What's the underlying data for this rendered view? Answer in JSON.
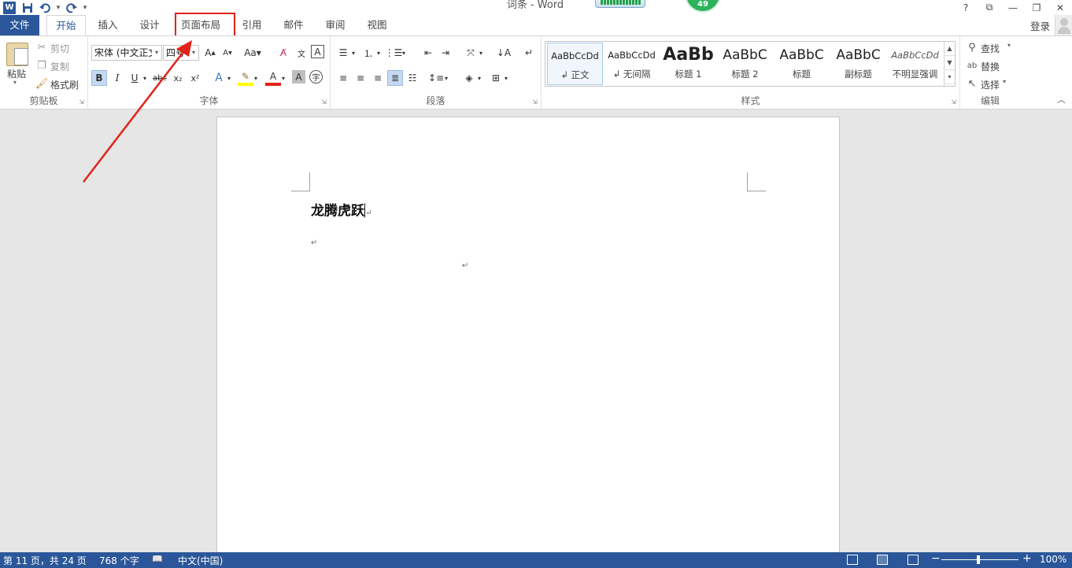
{
  "window": {
    "title": "词条 - Word",
    "help": "?",
    "restore_ribbon": "⧉",
    "minimize": "—",
    "maximize": "❐",
    "close": "✕",
    "overlay_badge": "49"
  },
  "qat": {
    "logo": "W",
    "save": "save-icon",
    "undo": "undo-icon",
    "redo": "redo-icon",
    "customize": "▾"
  },
  "tabs": [
    {
      "label": "文件"
    },
    {
      "label": "开始"
    },
    {
      "label": "插入"
    },
    {
      "label": "设计"
    },
    {
      "label": "页面布局"
    },
    {
      "label": "引用"
    },
    {
      "label": "邮件"
    },
    {
      "label": "审阅"
    },
    {
      "label": "视图"
    }
  ],
  "account": {
    "login": "登录"
  },
  "ribbon": {
    "clipboard": {
      "label": "剪贴板",
      "paste": "粘贴",
      "cut": "剪切",
      "copy": "复制",
      "format_painter": "格式刷"
    },
    "font": {
      "label": "字体",
      "font_name": "宋体 (中文正文",
      "font_size": "四号"
    },
    "paragraph": {
      "label": "段落"
    },
    "styles": {
      "label": "样式",
      "items": [
        {
          "sample": "AaBbCcDd",
          "name": "↲ 正文"
        },
        {
          "sample": "AaBbCcDd",
          "name": "↲ 无间隔"
        },
        {
          "sample": "AaBb",
          "name": "标题 1"
        },
        {
          "sample": "AaBbC",
          "name": "标题 2"
        },
        {
          "sample": "AaBbC",
          "name": "标题"
        },
        {
          "sample": "AaBbC",
          "name": "副标题"
        },
        {
          "sample": "AaBbCcDd",
          "name": "不明显强调"
        }
      ]
    },
    "editing": {
      "label": "编辑",
      "find": "查找",
      "replace": "替换",
      "select": "选择"
    }
  },
  "document": {
    "text": "龙腾虎跃",
    "para_mark": "↵"
  },
  "status": {
    "page": "第 11 页，共 24 页",
    "words": "768 个字",
    "language": "中文(中国)",
    "zoom": "100%",
    "zoom_minus": "−",
    "zoom_plus": "+"
  },
  "colors": {
    "accent": "#2b579a",
    "highlight_box": "#e2231a"
  }
}
